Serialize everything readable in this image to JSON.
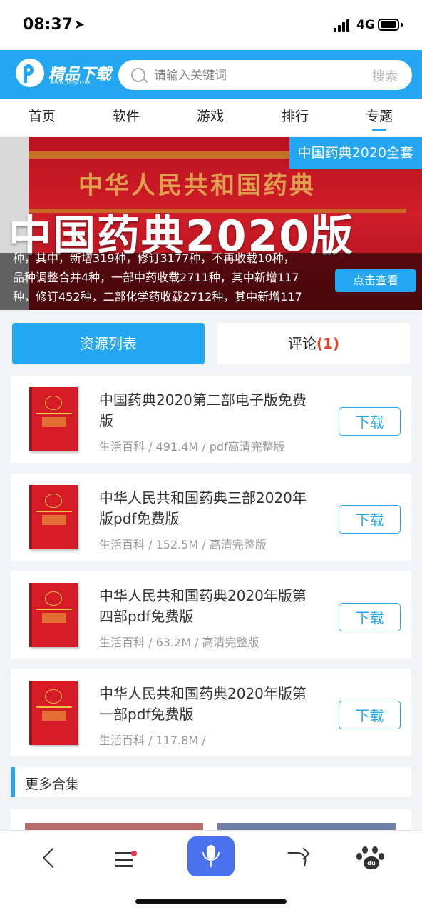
{
  "status_bar": {
    "time": "08:37",
    "location_icon": "location-arrow-icon",
    "network": "4G"
  },
  "header": {
    "logo_text": "精品下载",
    "logo_url": "www.jb9p.com",
    "search_placeholder": "请输入关键词",
    "search_button": "搜索"
  },
  "nav": {
    "tabs": [
      {
        "label": "首页"
      },
      {
        "label": "软件"
      },
      {
        "label": "游戏"
      },
      {
        "label": "排行"
      },
      {
        "label": "专题"
      }
    ],
    "active": "专题"
  },
  "banner": {
    "tag": "中国药典2020全套",
    "book_spine_text": "中华人民共和国药典",
    "big_title": "中国药典2020版",
    "desc_lines": [
      "种，其中，新增319种，修订3177种，不再收载10种，",
      "品种调整合并4种，一部中药收载2711种，其中新增117",
      "种，修订452种，二部化学药收载2712种，其中新增117"
    ],
    "button": "点击查看"
  },
  "section_tabs": {
    "resources": "资源列表",
    "comments": "评论",
    "comment_count": "(1)"
  },
  "items": [
    {
      "title": "中国药典2020第二部电子版免费版",
      "category": "生活百科",
      "size": "491.4M",
      "meta_tail": "pdf高清完整版",
      "meta": "生活百科 / 491.4M / pdf高清完整版",
      "button": "下载"
    },
    {
      "title": "中华人民共和国药典三部2020年版pdf免费版",
      "category": "生活百科",
      "size": "152.5M",
      "meta_tail": "高清完整版",
      "meta": "生活百科 / 152.5M / 高清完整版",
      "button": "下载"
    },
    {
      "title": "中华人民共和国药典2020年版第四部pdf免费版",
      "category": "生活百科",
      "size": "63.2M",
      "meta_tail": "高清完整版",
      "meta": "生活百科 / 63.2M / 高清完整版",
      "button": "下载"
    },
    {
      "title": "中华人民共和国药典2020年版第一部pdf免费版",
      "category": "生活百科",
      "size": "117.8M",
      "meta_tail": "",
      "meta": "生活百科 / 117.8M /",
      "button": "下载"
    }
  ],
  "more": {
    "label": "更多合集"
  },
  "toolbar": {
    "icons": [
      "back-icon",
      "menu-icon",
      "voice-icon",
      "share-icon",
      "baidu-icon"
    ],
    "baidu_text": "du"
  },
  "colors": {
    "accent": "#23a7f2",
    "badge_red": "#e2432b",
    "voice_blue": "#4a72ee"
  }
}
